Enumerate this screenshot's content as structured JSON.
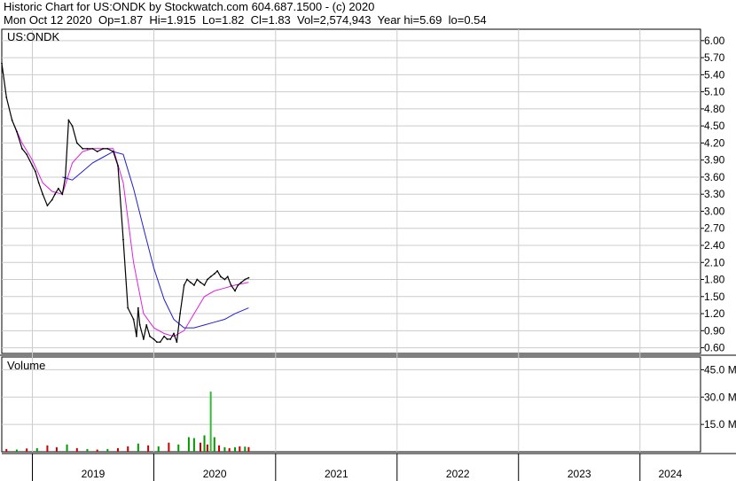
{
  "header": {
    "line1": "Historic Chart for US:ONDK by Stockwatch.com 604.687.1500 - (c) 2020",
    "line2": "Mon Oct 12 2020  Op=1.87  Hi=1.915  Lo=1.82  Cl=1.83  Vol=2,574,943  Year hi=5.69  lo=0.54"
  },
  "colors": {
    "price": "#000000",
    "ma_short": "#e020e0",
    "ma_long": "#2020d0",
    "volume_up": "#009900",
    "volume_down": "#cc0000",
    "volume_spike": "#33bb33",
    "grid": "#cccccc"
  },
  "chart_data": [
    {
      "type": "line",
      "panel": "price",
      "title": "US:ONDK",
      "ylim": [
        0.5,
        6.2
      ],
      "y_ticks": [
        "6.00",
        "5.70",
        "5.40",
        "5.10",
        "4.80",
        "4.50",
        "4.20",
        "3.90",
        "3.60",
        "3.30",
        "3.00",
        "2.70",
        "2.40",
        "2.10",
        "1.80",
        "1.50",
        "1.20",
        "0.90",
        "0.60"
      ],
      "y_tick_values": [
        6.0,
        5.7,
        5.4,
        5.1,
        4.8,
        4.5,
        4.2,
        3.9,
        3.6,
        3.3,
        3.0,
        2.7,
        2.4,
        2.1,
        1.8,
        1.5,
        1.2,
        0.9,
        0.6
      ],
      "xlim": [
        "2018-10-01",
        "2024-07-01"
      ],
      "series": [
        {
          "role": "price",
          "x": [
            "2018-10-01",
            "2018-10-15",
            "2018-11-01",
            "2018-11-15",
            "2018-12-01",
            "2018-12-15",
            "2019-01-01",
            "2019-01-10",
            "2019-01-20",
            "2019-02-01",
            "2019-02-15",
            "2019-03-01",
            "2019-03-10",
            "2019-03-20",
            "2019-04-01",
            "2019-04-10",
            "2019-04-20",
            "2019-05-01",
            "2019-05-15",
            "2019-06-01",
            "2019-06-15",
            "2019-07-01",
            "2019-07-15",
            "2019-08-01",
            "2019-08-15",
            "2019-09-01",
            "2019-09-15",
            "2019-10-01",
            "2019-10-15",
            "2019-11-01",
            "2019-11-10",
            "2019-11-15",
            "2019-11-20",
            "2019-12-01",
            "2019-12-10",
            "2019-12-20",
            "2020-01-01",
            "2020-01-10",
            "2020-01-20",
            "2020-02-01",
            "2020-02-10",
            "2020-02-20",
            "2020-03-01",
            "2020-03-10",
            "2020-03-20",
            "2020-04-01",
            "2020-04-10",
            "2020-04-20",
            "2020-05-01",
            "2020-05-10",
            "2020-05-20",
            "2020-06-01",
            "2020-06-10",
            "2020-06-20",
            "2020-07-01",
            "2020-07-10",
            "2020-07-20",
            "2020-08-01",
            "2020-08-10",
            "2020-08-20",
            "2020-09-01",
            "2020-09-10",
            "2020-09-20",
            "2020-10-01",
            "2020-10-12"
          ],
          "values": [
            5.6,
            5.0,
            4.6,
            4.4,
            4.1,
            4.0,
            3.8,
            3.7,
            3.5,
            3.3,
            3.1,
            3.2,
            3.3,
            3.4,
            3.3,
            3.6,
            4.6,
            4.5,
            4.2,
            4.1,
            4.1,
            4.1,
            4.05,
            4.1,
            4.1,
            4.05,
            3.8,
            2.5,
            1.3,
            1.1,
            0.8,
            1.3,
            1.0,
            0.75,
            1.0,
            0.8,
            0.75,
            0.7,
            0.7,
            0.8,
            0.75,
            0.75,
            0.85,
            0.7,
            1.2,
            1.7,
            1.8,
            1.75,
            1.7,
            1.8,
            1.75,
            1.7,
            1.8,
            1.85,
            1.9,
            1.95,
            1.85,
            1.8,
            1.85,
            1.7,
            1.6,
            1.7,
            1.75,
            1.8,
            1.83
          ]
        },
        {
          "role": "ma_short",
          "x": [
            "2018-11-01",
            "2018-12-01",
            "2019-01-01",
            "2019-02-01",
            "2019-03-01",
            "2019-04-01",
            "2019-05-01",
            "2019-06-01",
            "2019-07-01",
            "2019-08-01",
            "2019-09-01",
            "2019-10-01",
            "2019-11-01",
            "2019-12-01",
            "2020-01-01",
            "2020-02-01",
            "2020-03-01",
            "2020-04-01",
            "2020-05-01",
            "2020-06-01",
            "2020-07-01",
            "2020-08-01",
            "2020-09-01",
            "2020-10-12"
          ],
          "values": [
            4.6,
            4.2,
            3.9,
            3.5,
            3.35,
            3.3,
            3.85,
            4.05,
            4.1,
            4.1,
            4.1,
            3.5,
            2.1,
            1.2,
            0.95,
            0.85,
            0.8,
            0.9,
            1.2,
            1.5,
            1.6,
            1.65,
            1.7,
            1.75
          ]
        },
        {
          "role": "ma_long",
          "x": [
            "2019-04-01",
            "2019-05-01",
            "2019-06-01",
            "2019-07-01",
            "2019-08-01",
            "2019-09-01",
            "2019-10-01",
            "2019-11-01",
            "2019-12-01",
            "2020-01-01",
            "2020-02-01",
            "2020-03-01",
            "2020-04-01",
            "2020-05-01",
            "2020-06-01",
            "2020-07-01",
            "2020-08-01",
            "2020-09-01",
            "2020-10-12"
          ],
          "values": [
            3.6,
            3.55,
            3.7,
            3.85,
            3.95,
            4.05,
            4.0,
            3.4,
            2.7,
            2.0,
            1.45,
            1.1,
            0.95,
            0.95,
            1.0,
            1.05,
            1.1,
            1.2,
            1.3
          ]
        }
      ]
    },
    {
      "type": "bar",
      "panel": "volume",
      "title": "Volume",
      "ylim": [
        0,
        52000000
      ],
      "y_ticks": [
        "45.0 M",
        "30.0 M",
        "15.0 M"
      ],
      "y_tick_values": [
        45000000,
        30000000,
        15000000
      ],
      "x": [
        "2018-10-15",
        "2018-11-15",
        "2018-12-15",
        "2019-01-15",
        "2019-02-15",
        "2019-03-15",
        "2019-04-15",
        "2019-05-15",
        "2019-06-15",
        "2019-07-15",
        "2019-08-15",
        "2019-09-15",
        "2019-10-15",
        "2019-11-15",
        "2019-12-15",
        "2020-01-15",
        "2020-02-15",
        "2020-03-15",
        "2020-04-15",
        "2020-05-01",
        "2020-05-20",
        "2020-06-01",
        "2020-06-10",
        "2020-06-20",
        "2020-07-01",
        "2020-07-15",
        "2020-08-01",
        "2020-08-15",
        "2020-09-01",
        "2020-09-15",
        "2020-10-01",
        "2020-10-12"
      ],
      "values": [
        1500000,
        1200000,
        1800000,
        2000000,
        3500000,
        2500000,
        4000000,
        2000000,
        1500000,
        1200000,
        1500000,
        2000000,
        3000000,
        4500000,
        3500000,
        3000000,
        5000000,
        4000000,
        8000000,
        7500000,
        5000000,
        9000000,
        4000000,
        33000000,
        8000000,
        3500000,
        2500000,
        2000000,
        2500000,
        3000000,
        2800000,
        2574943
      ],
      "up": [
        false,
        true,
        false,
        true,
        false,
        false,
        true,
        false,
        true,
        false,
        true,
        false,
        false,
        true,
        false,
        true,
        false,
        true,
        true,
        true,
        false,
        true,
        false,
        true,
        true,
        false,
        true,
        false,
        true,
        false,
        true,
        false
      ]
    }
  ],
  "x_axis": {
    "years": [
      "2019",
      "2020",
      "2021",
      "2022",
      "2023",
      "2024"
    ]
  }
}
